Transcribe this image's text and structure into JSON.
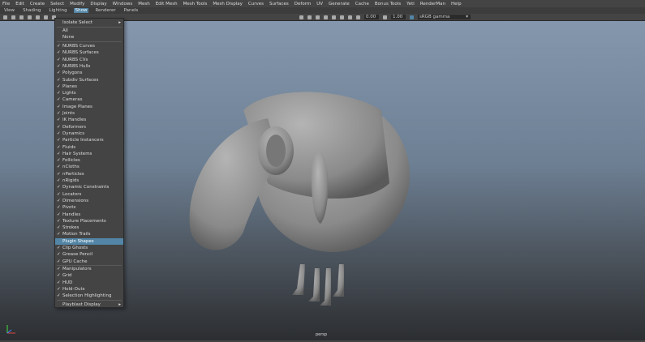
{
  "menubar": [
    "File",
    "Edit",
    "Create",
    "Select",
    "Modify",
    "Display",
    "Windows",
    "Mesh",
    "Edit Mesh",
    "Mesh Tools",
    "Mesh Display",
    "Curves",
    "Surfaces",
    "Deform",
    "UV",
    "Generate",
    "Cache",
    "Bonus Tools",
    "Yeti",
    "RenderMan",
    "Help"
  ],
  "panelbar": [
    "View",
    "Shading",
    "Lighting",
    "Show",
    "Renderer",
    "Panels"
  ],
  "toolbar": {
    "exposure": "0.00",
    "gamma": "1.00",
    "color_space": "sRGB gamma"
  },
  "camera_label": "persp",
  "show_menu": {
    "isolate": "Isolate Select",
    "all": "All",
    "none": "None",
    "objects": [
      {
        "label": "NURBS Curves",
        "checked": true
      },
      {
        "label": "NURBS Surfaces",
        "checked": true
      },
      {
        "label": "NURBS CVs",
        "checked": true
      },
      {
        "label": "NURBS Hulls",
        "checked": true
      },
      {
        "label": "Polygons",
        "checked": true
      },
      {
        "label": "Subdiv Surfaces",
        "checked": true
      },
      {
        "label": "Planes",
        "checked": true
      },
      {
        "label": "Lights",
        "checked": true
      },
      {
        "label": "Cameras",
        "checked": true
      },
      {
        "label": "Image Planes",
        "checked": true
      },
      {
        "label": "Joints",
        "checked": true
      },
      {
        "label": "IK Handles",
        "checked": true
      },
      {
        "label": "Deformers",
        "checked": true
      },
      {
        "label": "Dynamics",
        "checked": true
      },
      {
        "label": "Particle Instancers",
        "checked": true
      },
      {
        "label": "Fluids",
        "checked": true
      },
      {
        "label": "Hair Systems",
        "checked": true
      },
      {
        "label": "Follicles",
        "checked": true
      },
      {
        "label": "nCloths",
        "checked": true
      },
      {
        "label": "nParticles",
        "checked": true
      },
      {
        "label": "nRigids",
        "checked": true
      },
      {
        "label": "Dynamic Constraints",
        "checked": true
      },
      {
        "label": "Locators",
        "checked": true
      },
      {
        "label": "Dimensions",
        "checked": true
      },
      {
        "label": "Pivots",
        "checked": true
      },
      {
        "label": "Handles",
        "checked": true
      },
      {
        "label": "Texture Placements",
        "checked": true
      },
      {
        "label": "Strokes",
        "checked": true
      },
      {
        "label": "Motion Trails",
        "checked": true
      },
      {
        "label": "Plugin Shapes",
        "checked": false,
        "highlighted": true
      },
      {
        "label": "Clip Ghosts",
        "checked": true
      },
      {
        "label": "Grease Pencil",
        "checked": true
      },
      {
        "label": "GPU Cache",
        "checked": true
      }
    ],
    "display": [
      {
        "label": "Manipulators",
        "checked": true
      },
      {
        "label": "Grid",
        "checked": true
      },
      {
        "label": "HUD",
        "checked": true
      },
      {
        "label": "Hold-Outs",
        "checked": true
      },
      {
        "label": "Selection Highlighting",
        "checked": true
      }
    ],
    "playblast": "Playblast Display"
  }
}
